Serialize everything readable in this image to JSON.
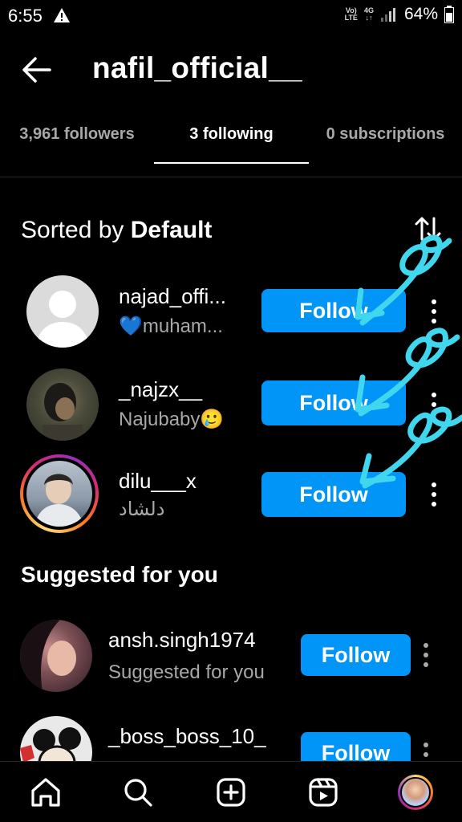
{
  "status_bar": {
    "time": "6:55",
    "net_top": "Vo)",
    "net_bottom": "LTE",
    "data_label": "4G",
    "battery": "64%"
  },
  "header": {
    "title": "nafil_official__"
  },
  "tabs": [
    {
      "label": "3,961 followers",
      "active": false
    },
    {
      "label": "3 following",
      "active": true
    },
    {
      "label": "0 subscriptions",
      "active": false
    }
  ],
  "sort": {
    "prefix": "Sorted by ",
    "value": "Default"
  },
  "following": [
    {
      "username": "najad_offi...",
      "subtitle": "💙muham...",
      "button": "Follow",
      "avatar": "default-avatar"
    },
    {
      "username": "_najzx__",
      "subtitle": "Najubaby🥲",
      "button": "Follow",
      "avatar": "photo-avatar"
    },
    {
      "username": "dilu___x",
      "subtitle": "دلشاد",
      "button": "Follow",
      "avatar": "story-ring-avatar"
    }
  ],
  "suggested": {
    "title": "Suggested for you",
    "items": [
      {
        "username": "ansh.singh1974",
        "subtitle": "Suggested for you",
        "button": "Follow"
      },
      {
        "username": "_boss_boss_10_",
        "subtitle": "",
        "button": "Follow"
      }
    ]
  },
  "colors": {
    "accent": "#0095f6",
    "scribble": "#3fd6ee",
    "muted_text": "#a8a8a8"
  },
  "nav": {
    "icons": [
      "home-icon",
      "search-icon",
      "create-icon",
      "reels-icon",
      "profile-icon"
    ]
  }
}
